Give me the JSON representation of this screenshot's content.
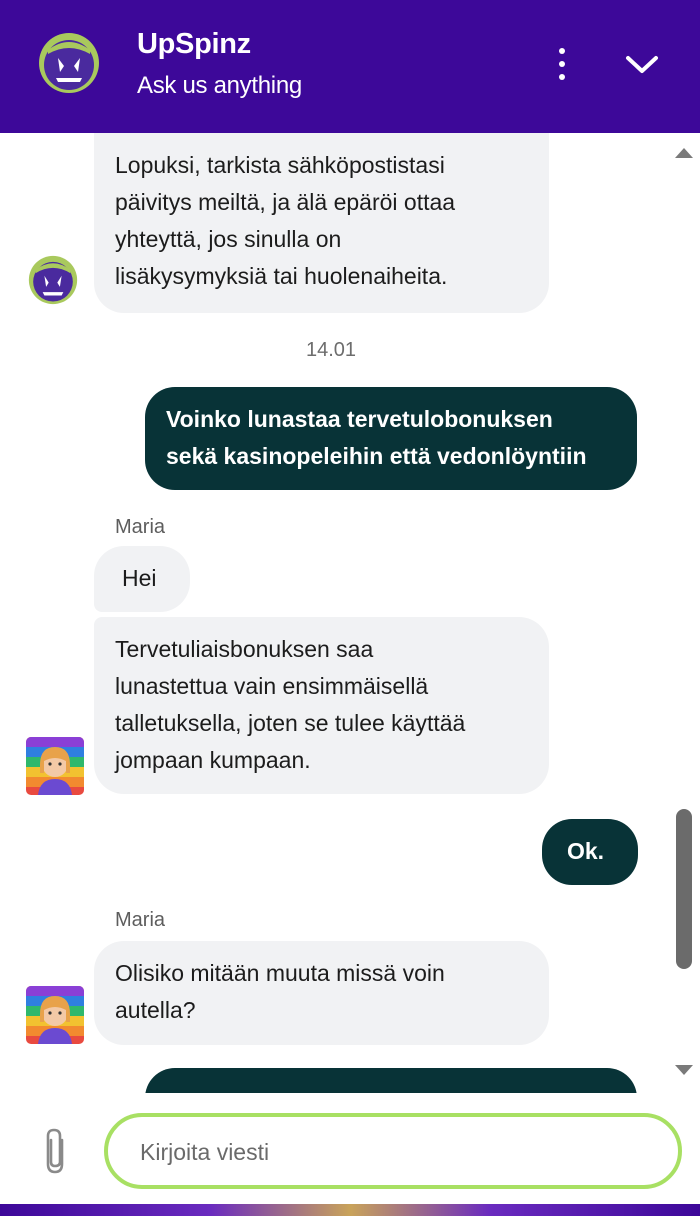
{
  "header": {
    "brand": "UpSpinz",
    "tagline": "Ask us anything",
    "colors": {
      "background": "#3d0899",
      "text": "#ffffff"
    }
  },
  "messages": [
    {
      "direction": "incoming",
      "lines": [
        "Lopuksi, tarkista sähköpostistasi",
        "päivitys meiltä, ja älä epäröi ottaa",
        "yhteyttä, jos sinulla on",
        "lisäkysymyksiä tai huolenaiheita."
      ]
    },
    {
      "timestamp": "14.01"
    },
    {
      "direction": "outgoing",
      "lines": [
        "Voinko lunastaa tervetulobonuksen",
        "sekä kasinopeleihin että vedonlöyntiin"
      ]
    },
    {
      "sender": "Maria"
    },
    {
      "direction": "incoming",
      "lines": [
        "Hei"
      ]
    },
    {
      "direction": "incoming",
      "lines": [
        "Tervetuliaisbonuksen saa",
        "lunastettua vain ensimmäisellä",
        "talletuksella, joten se tulee käyttää",
        "jompaan kumpaan."
      ]
    },
    {
      "direction": "outgoing",
      "lines": [
        "Ok."
      ]
    },
    {
      "sender": "Maria"
    },
    {
      "direction": "incoming",
      "lines": [
        "Olisiko mitään muuta missä voin",
        "autella?"
      ]
    }
  ],
  "composer": {
    "placeholder": "Kirjoita viesti",
    "value": ""
  },
  "icons": {
    "menu": "more-vertical-icon",
    "collapse": "chevron-down-icon",
    "attach": "paperclip-icon"
  },
  "colors": {
    "incoming_bubble": "#f1f2f4",
    "outgoing_bubble": "#083337",
    "input_border": "#a8e063"
  }
}
